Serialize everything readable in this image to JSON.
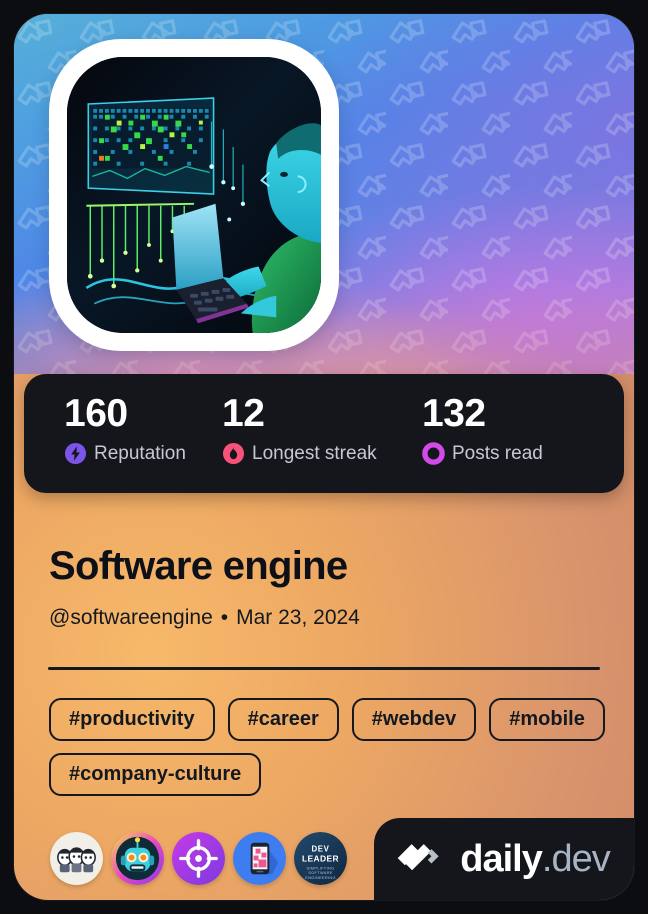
{
  "card": {
    "accent_orange": "#eda863",
    "stats_bg": "#14161b",
    "text_dark": "#14181f"
  },
  "cover": {
    "watermark_icon": "daily-dev-chevron-pattern",
    "gradient_from": "#58b4d6",
    "gradient_to": "#c185cf"
  },
  "avatar": {
    "alt": "Developer at laptop with neon data visualization"
  },
  "stats": [
    {
      "value": "160",
      "label": "Reputation",
      "icon": "reputation-bolt-icon",
      "color": "#7b55e8"
    },
    {
      "value": "12",
      "label": "Longest streak",
      "icon": "streak-flame-icon",
      "color": "#f8527a"
    },
    {
      "value": "132",
      "label": "Posts read",
      "icon": "posts-read-ring-icon",
      "color": "#d24ae8"
    }
  ],
  "profile": {
    "name": "Software engine",
    "handle": "@softwareengine",
    "separator": "•",
    "date": "Mar 23, 2024"
  },
  "tags": [
    "#productivity",
    "#career",
    "#webdev",
    "#mobile",
    "#company-culture"
  ],
  "badges": [
    {
      "name": "community-trio-badge",
      "title": "Community"
    },
    {
      "name": "robot-badge",
      "title": "Robot"
    },
    {
      "name": "target-crosshair-badge",
      "title": "Target"
    },
    {
      "name": "mobile-phone-badge",
      "title": "Mobile"
    },
    {
      "name": "dev-leader-badge",
      "title": "DEV LEADER",
      "line1": "DEV",
      "line2": "LEADER",
      "sub1": "SIMPLIFYING",
      "sub2": "SOFTWARE",
      "sub3": "ENGINEERING"
    }
  ],
  "logo": {
    "mark": "daily-dev-logo-icon",
    "primary": "daily",
    "secondary": ".dev"
  }
}
